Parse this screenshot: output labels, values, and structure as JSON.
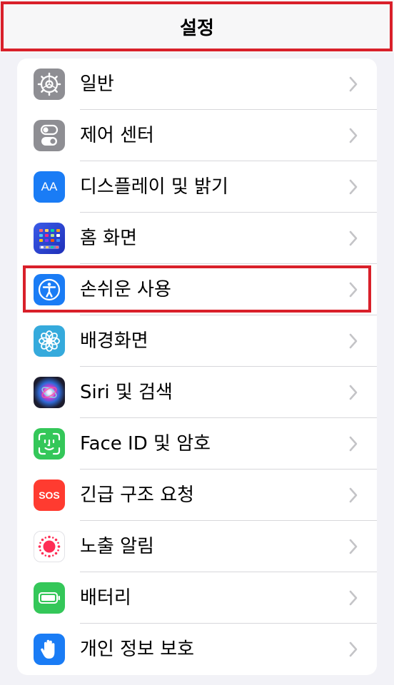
{
  "nav": {
    "title": "설정"
  },
  "colors": {
    "highlight": "#d9202a",
    "background": "#f2f2f7",
    "chevron": "#c4c4c7"
  },
  "items": [
    {
      "label": "일반",
      "icon": "gear-icon",
      "color": "#8e8e93"
    },
    {
      "label": "제어 센터",
      "icon": "toggles-icon",
      "color": "#8e8e93"
    },
    {
      "label": "디스플레이 및 밝기",
      "icon": "aa-icon",
      "glyph": "AA",
      "color": "#1a7cf5"
    },
    {
      "label": "홈 화면",
      "icon": "home-grid-icon",
      "color": "#2b4ee0"
    },
    {
      "label": "손쉬운 사용",
      "icon": "accessibility-icon",
      "color": "#1a7cf5",
      "highlighted": true
    },
    {
      "label": "배경화면",
      "icon": "flower-icon",
      "color": "#35aadc"
    },
    {
      "label": "Siri 및 검색",
      "icon": "siri-icon",
      "color": "#1c1c2e"
    },
    {
      "label": "Face ID 및 암호",
      "icon": "face-id-icon",
      "color": "#34c759"
    },
    {
      "label": "긴급 구조 요청",
      "icon": "sos-icon",
      "glyph": "SOS",
      "color": "#ff3b30"
    },
    {
      "label": "노출 알림",
      "icon": "exposure-icon",
      "color": "#ffffff"
    },
    {
      "label": "배터리",
      "icon": "battery-icon",
      "color": "#34c759"
    },
    {
      "label": "개인 정보 보호",
      "icon": "hand-icon",
      "color": "#1a7cf5"
    }
  ]
}
